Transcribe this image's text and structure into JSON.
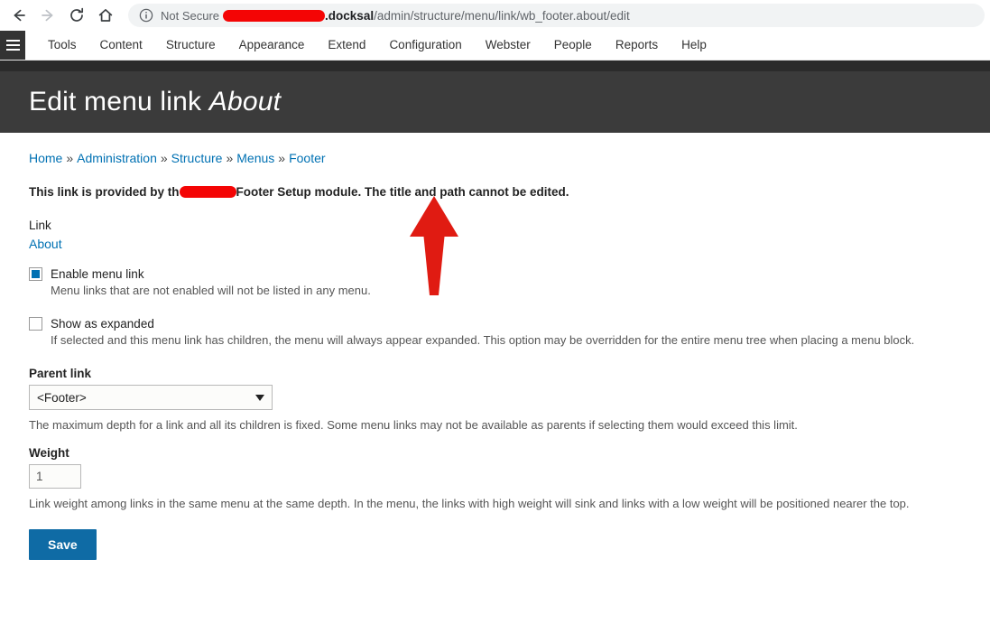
{
  "browser": {
    "nav": {
      "back_icon": "arrow-left-icon",
      "forward_icon": "arrow-right-icon",
      "reload_icon": "reload-icon",
      "home_icon": "home-icon"
    },
    "omnibox": {
      "info_icon": "info-circle-icon",
      "security_label": "Not Secure",
      "redacted_host": "",
      "host_suffix": ".docksal",
      "path": "/admin/structure/menu/link/wb_footer.about/edit"
    }
  },
  "admin_toolbar": {
    "menu_icon": "hamburger-menu-icon",
    "items": [
      {
        "label": "Tools"
      },
      {
        "label": "Content"
      },
      {
        "label": "Structure"
      },
      {
        "label": "Appearance"
      },
      {
        "label": "Extend"
      },
      {
        "label": "Configuration"
      },
      {
        "label": "Webster"
      },
      {
        "label": "People"
      },
      {
        "label": "Reports"
      },
      {
        "label": "Help"
      }
    ]
  },
  "page": {
    "title_prefix": "Edit menu link ",
    "title_emphasis": "About"
  },
  "breadcrumb": {
    "separator": "»",
    "items": [
      {
        "label": "Home"
      },
      {
        "label": "Administration"
      },
      {
        "label": "Structure"
      },
      {
        "label": "Menus"
      },
      {
        "label": "Footer"
      }
    ]
  },
  "notice": {
    "text_before": "This link is provided by th",
    "text_after": "Footer Setup module. The title and path cannot be edited."
  },
  "form": {
    "link": {
      "label": "Link",
      "value": "About"
    },
    "enabled": {
      "label": "Enable menu link",
      "checked": true,
      "description": "Menu links that are not enabled will not be listed in any menu."
    },
    "expanded": {
      "label": "Show as expanded",
      "checked": false,
      "description": "If selected and this menu link has children, the menu will always appear expanded. This option may be overridden for the entire menu tree when placing a menu block."
    },
    "parent": {
      "label": "Parent link",
      "selected": "<Footer>",
      "options": [
        "<Footer>"
      ],
      "description": "The maximum depth for a link and all its children is fixed. Some menu links may not be available as parents if selecting them would exceed this limit."
    },
    "weight": {
      "label": "Weight",
      "value": "1",
      "description": "Link weight among links in the same menu at the same depth. In the menu, the links with high weight will sink and links with a low weight will be positioned nearer the top."
    },
    "save": {
      "label": "Save"
    }
  },
  "annotation": {
    "arrow_icon": "red-up-arrow-annotation",
    "color": "#e01b12"
  },
  "colors": {
    "accent_blue": "#0071b3",
    "button_blue": "#0f6ba5",
    "header_dark": "#3b3b3b",
    "strip_dark": "#2b2b2b",
    "redaction_red": "#f40505"
  }
}
